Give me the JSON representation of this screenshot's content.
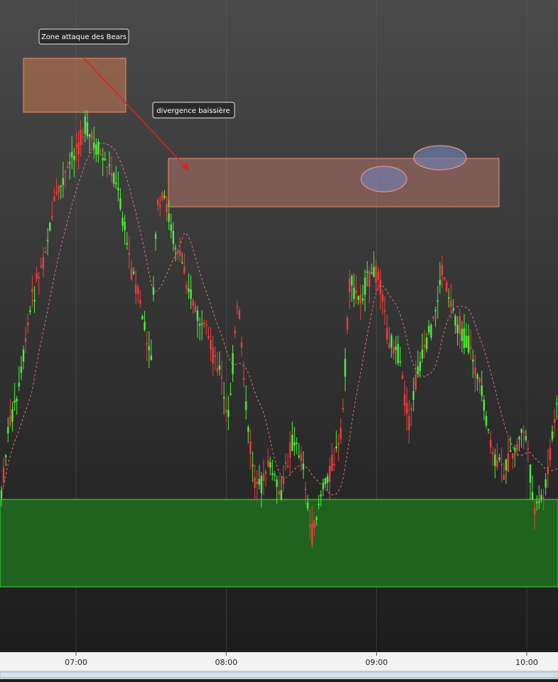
{
  "chart_data": {
    "type": "candlestick",
    "x_tick_labels": [
      "07:00",
      "08:00",
      "09:00",
      "10:00"
    ],
    "x_tick_times_min": [
      420,
      480,
      540,
      600
    ],
    "annotations": [
      {
        "id": "zone-bears",
        "text": "Zone attaque des Bears"
      },
      {
        "id": "divergence",
        "text": "divergence baissière"
      }
    ],
    "zones": [
      {
        "id": "bears-zone",
        "kind": "resistance",
        "color": "#c87850"
      },
      {
        "id": "divergence-zone",
        "kind": "resistance",
        "color": "#c88070"
      },
      {
        "id": "support-zone",
        "kind": "support",
        "color": "#1f6a1f"
      }
    ],
    "highlights": [
      {
        "id": "peak-1",
        "label": ""
      },
      {
        "id": "peak-2",
        "label": ""
      }
    ],
    "moving_average": {
      "style": "dashed",
      "color": "#e0786c"
    },
    "colors": {
      "up": "#4cf03c",
      "down": "#f03c3c",
      "annotation_border": "#e8e8e8",
      "annotation_bg": "#2a2a2a"
    },
    "grid": true
  }
}
